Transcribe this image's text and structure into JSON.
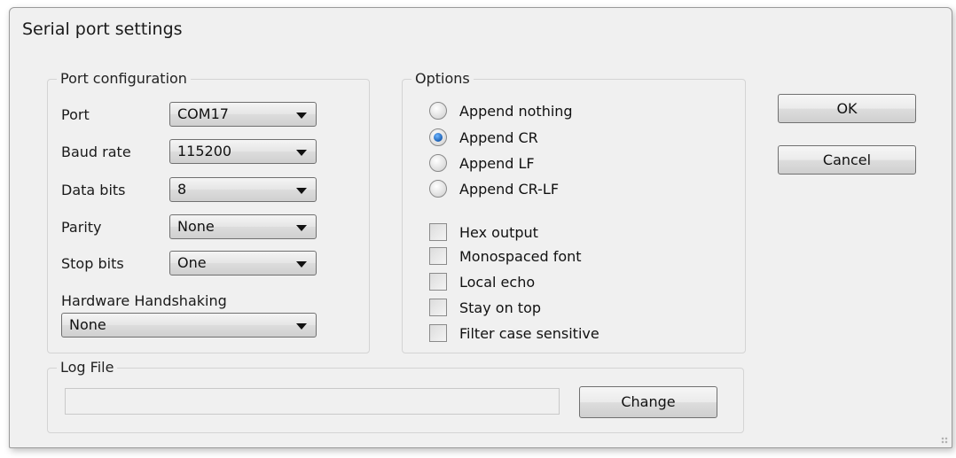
{
  "dialog": {
    "title": "Serial port settings"
  },
  "port_config": {
    "title": "Port configuration",
    "fields": [
      {
        "label": "Port",
        "value": "COM17"
      },
      {
        "label": "Baud rate",
        "value": "115200"
      },
      {
        "label": "Data bits",
        "value": "8"
      },
      {
        "label": "Parity",
        "value": "None"
      },
      {
        "label": "Stop bits",
        "value": "One"
      }
    ],
    "handshaking_label": "Hardware Handshaking",
    "handshaking_value": "None"
  },
  "options": {
    "title": "Options",
    "radios": [
      {
        "label": "Append nothing",
        "checked": false
      },
      {
        "label": "Append CR",
        "checked": true
      },
      {
        "label": "Append LF",
        "checked": false
      },
      {
        "label": "Append CR-LF",
        "checked": false
      }
    ],
    "checkboxes": [
      {
        "label": "Hex output",
        "checked": false
      },
      {
        "label": "Monospaced font",
        "checked": false
      },
      {
        "label": "Local echo",
        "checked": false
      },
      {
        "label": "Stay on top",
        "checked": false
      },
      {
        "label": "Filter case sensitive",
        "checked": false
      }
    ]
  },
  "log_file": {
    "title": "Log File",
    "path": "",
    "change_label": "Change"
  },
  "buttons": {
    "ok_label": "OK",
    "cancel_label": "Cancel"
  }
}
